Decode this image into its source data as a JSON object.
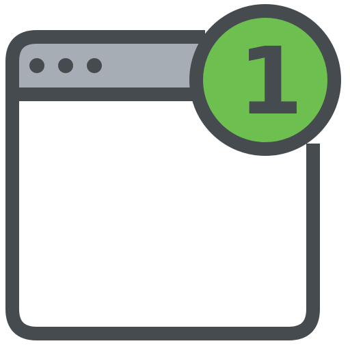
{
  "icon": {
    "name": "browser-window-notification-icon",
    "colors": {
      "outline": "#454B4F",
      "title_bar": "#A6ADB4",
      "window_body": "#FFFFFF",
      "dot": "#454B4F",
      "badge_fill": "#6DBF4F",
      "badge_outline": "#454B4F",
      "badge_digit": "#454B4F"
    },
    "dots_count": 3,
    "badge": {
      "count": 1
    }
  }
}
